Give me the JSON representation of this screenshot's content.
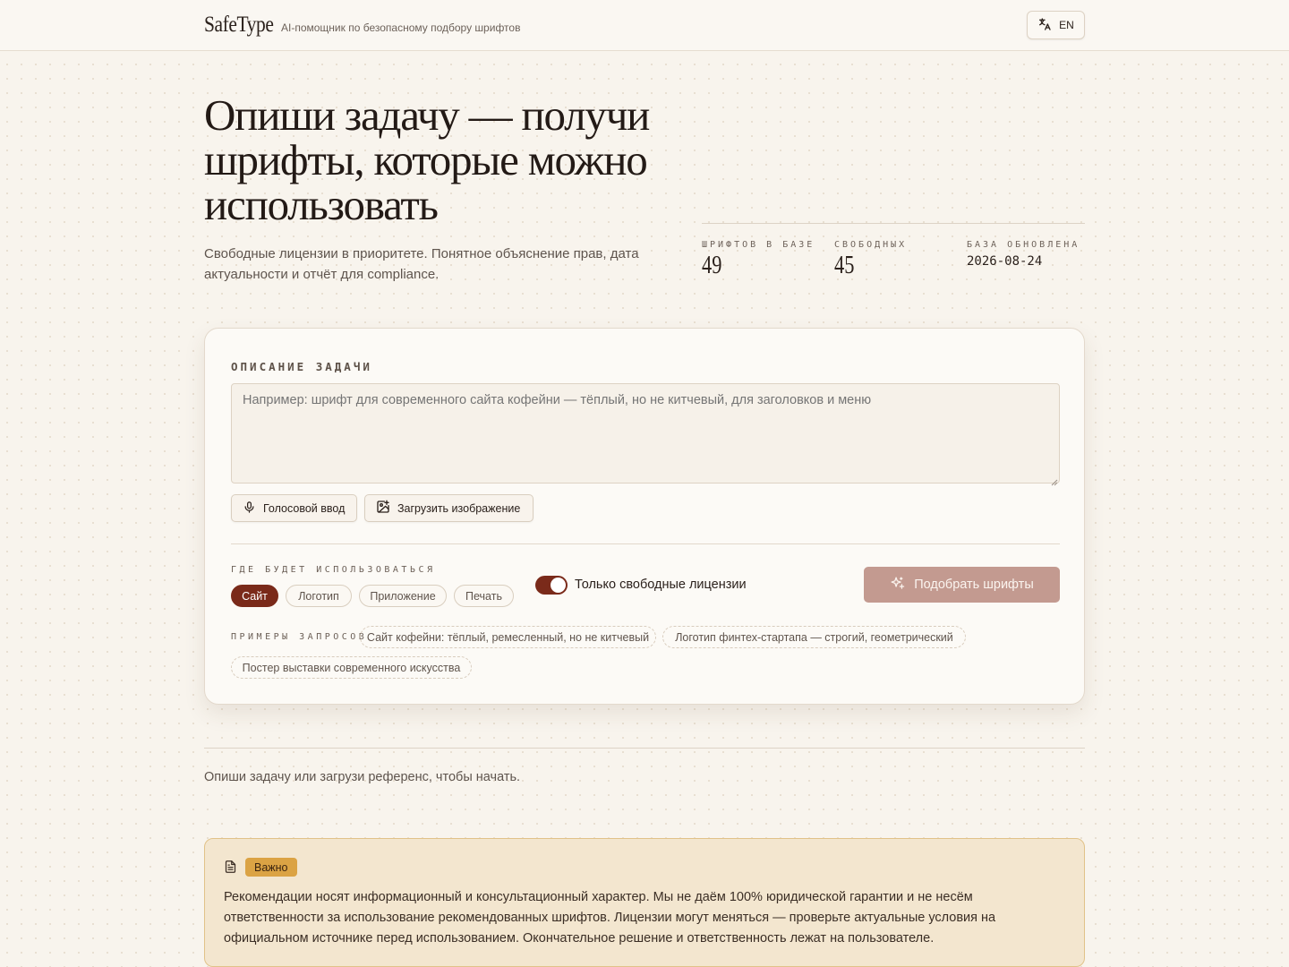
{
  "header": {
    "brand": "SafeType",
    "tagline": "AI-помощник по безопасному подбору шрифтов",
    "lang_button": "EN",
    "lang_icon": "translate-icon"
  },
  "hero": {
    "title": "Опиши задачу — получи шрифты, которые можно использовать",
    "subtitle": "Свободные лицензии в приоритете. Понятное объяснение прав, дата актуальности и отчёт для compliance.",
    "stats": [
      {
        "label": "Шрифтов в базе",
        "value": "49"
      },
      {
        "label": "Свободных",
        "value": "45"
      },
      {
        "label": "База обновлена",
        "value": "2026-08-24"
      }
    ]
  },
  "form": {
    "task_label": "ОПИСАНИЕ ЗАДАЧИ",
    "task_placeholder": "Например: шрифт для современного сайта кофейни — тёплый, но не китчевый, для заголовков и меню",
    "task_value": "",
    "voice_button": "Голосовой ввод",
    "upload_button": "Загрузить изображение",
    "usage_label": "Где будет использоваться",
    "usage_options": [
      "Сайт",
      "Логотип",
      "Приложение",
      "Печать"
    ],
    "usage_selected": "Сайт",
    "free_only_label": "Только свободные лицензии",
    "free_only_enabled": true,
    "submit_button": "Подобрать шрифты",
    "examples_label": "Примеры запросов",
    "examples": [
      "Сайт кофейни: тёплый, ремесленный, но не китчевый",
      "Логотип финтех-стартапа — строгий, геометрический",
      "Постер выставки современного искусства"
    ]
  },
  "empty_state": "Опиши задачу или загрузи референс, чтобы начать.",
  "notice": {
    "badge": "Важно",
    "text": "Рекомендации носят информационный и консультационный характер. Мы не даём 100% юридической гарантии и не несём ответственности за использование рекомендованных шрифтов. Лицензии могут меняться — проверьте актуальные условия на официальном источнике перед использованием. Окончательное решение и ответственность лежат на пользователе."
  },
  "colors": {
    "accent": "#7a2a1a",
    "submit_disabled": "#c39a90",
    "background": "#f8f4ed",
    "notice_bg": "#f3e6cf",
    "notice_badge": "#dba344"
  }
}
